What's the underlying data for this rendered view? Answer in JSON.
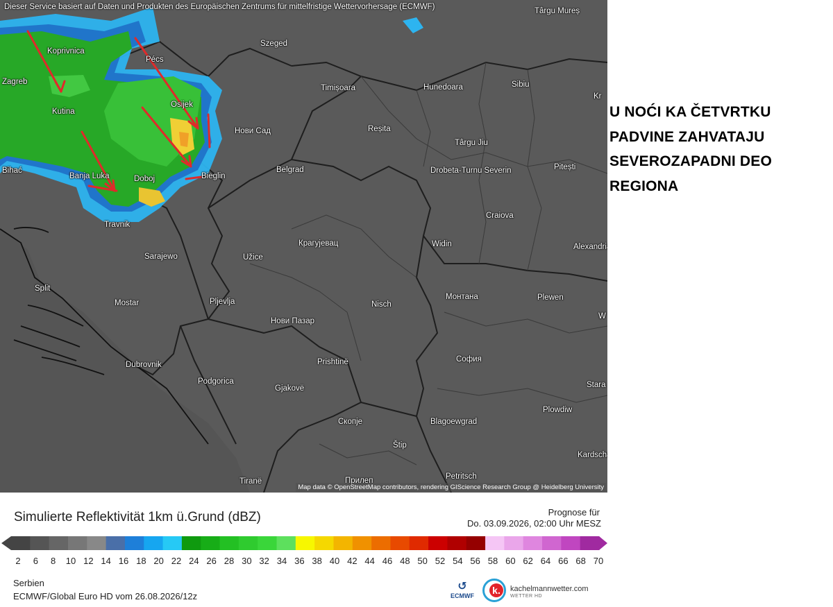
{
  "map": {
    "banner": "Dieser Service basiert auf Daten und Produkten des Europäischen Zentrums für mittelfristige Wettervorhersage (ECMWF)",
    "attribution": "Map data © OpenStreetMap contributors, rendering GIScience Research Group @ Heidelberg University",
    "cities": [
      {
        "name": "Koprivnica"
      },
      {
        "name": "Pécs"
      },
      {
        "name": "Szeged"
      },
      {
        "name": "Târgu Mureș"
      },
      {
        "name": "Zagreb"
      },
      {
        "name": "Timișoara"
      },
      {
        "name": "Hunedoara"
      },
      {
        "name": "Sibiu"
      },
      {
        "name": "Osijek"
      },
      {
        "name": "Kutina"
      },
      {
        "name": "Нови Сад"
      },
      {
        "name": "Reșita"
      },
      {
        "name": "Târgu Jiu"
      },
      {
        "name": "Pitești"
      },
      {
        "name": "Bihać"
      },
      {
        "name": "Banja Luka"
      },
      {
        "name": "Doboj"
      },
      {
        "name": "Bieglin"
      },
      {
        "name": "Belgrad"
      },
      {
        "name": "Drobeta-Turnu Severin"
      },
      {
        "name": "Craiova"
      },
      {
        "name": "Travnik"
      },
      {
        "name": "Крагујевац"
      },
      {
        "name": "Widin"
      },
      {
        "name": "Alexandria"
      },
      {
        "name": "Sarajewo"
      },
      {
        "name": "Užice"
      },
      {
        "name": "Split"
      },
      {
        "name": "Mostar"
      },
      {
        "name": "Pljevlja"
      },
      {
        "name": "Nisch"
      },
      {
        "name": "Монтана"
      },
      {
        "name": "Plewen"
      },
      {
        "name": "Нови Пазар"
      },
      {
        "name": "Prishtinë"
      },
      {
        "name": "София"
      },
      {
        "name": "Dubrovnik"
      },
      {
        "name": "Podgorica"
      },
      {
        "name": "Gjakovë"
      },
      {
        "name": "Stara"
      },
      {
        "name": "Скопје"
      },
      {
        "name": "Blagoewgrad"
      },
      {
        "name": "Plowdiw"
      },
      {
        "name": "Štip"
      },
      {
        "name": "Kardscha"
      },
      {
        "name": "Tiranë"
      },
      {
        "name": "Прилеп"
      },
      {
        "name": "Petritsch"
      },
      {
        "name": "Kr"
      },
      {
        "name": "W T"
      }
    ],
    "overlay_colors": {
      "light_precip": "#3aa33a",
      "moderate": "#e8c43a",
      "edge": "#3ab8e8",
      "arrow": "#e03030"
    }
  },
  "headline": {
    "text": "U NOĆI KA ČETVRTKU\nPADVINE ZAHVATAJU\nSEVEROZAPADNI DEO\nREGIONA"
  },
  "legend": {
    "title": "Simulierte Reflektivität 1km ü.Grund (dBZ)",
    "forecast_label": "Prognose für",
    "forecast_date": "Do. 03.09.2026, 02:00 Uhr MESZ",
    "ticks": [
      "2",
      "6",
      "8",
      "10",
      "12",
      "14",
      "16",
      "18",
      "20",
      "22",
      "24",
      "26",
      "28",
      "30",
      "32",
      "34",
      "36",
      "38",
      "40",
      "42",
      "44",
      "46",
      "48",
      "50",
      "52",
      "54",
      "56",
      "58",
      "60",
      "62",
      "64",
      "66",
      "68",
      "70"
    ],
    "scale_colors": [
      "#444444",
      "#555555",
      "#666666",
      "#777777",
      "#888888",
      "#4a6fa8",
      "#1e7fd9",
      "#16a6f0",
      "#26c9f5",
      "#0f9a0f",
      "#17ad17",
      "#23c023",
      "#2fcb2f",
      "#3ad63a",
      "#5de05d",
      "#f7f700",
      "#f5d800",
      "#f3b500",
      "#f09100",
      "#ec6d00",
      "#e84a00",
      "#e02a00",
      "#cc0000",
      "#b00000",
      "#950000",
      "#f5c6f5",
      "#eaa6ea",
      "#df86df",
      "#d066d0",
      "#c046c0",
      "#a02aa0"
    ]
  },
  "footer": {
    "region": "Serbien",
    "model": "ECMWF/Global Euro HD vom  26.08.2026/12z",
    "ecmwf_logo": "ECMWF",
    "brand": "kachelmannwetter.com",
    "brand_sub": "WETTER HD"
  }
}
